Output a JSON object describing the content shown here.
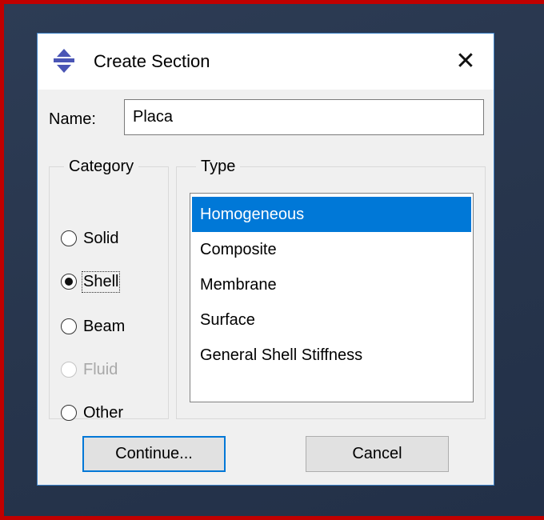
{
  "dialog": {
    "title": "Create Section",
    "close_glyph": "✕",
    "icon": "section-app-icon"
  },
  "name_field": {
    "label": "Name:",
    "value": "Placa"
  },
  "category": {
    "legend": "Category",
    "options": [
      {
        "label": "Solid",
        "checked": false,
        "disabled": false
      },
      {
        "label": "Shell",
        "checked": true,
        "disabled": false
      },
      {
        "label": "Beam",
        "checked": false,
        "disabled": false
      },
      {
        "label": "Fluid",
        "checked": false,
        "disabled": true
      },
      {
        "label": "Other",
        "checked": false,
        "disabled": false
      }
    ]
  },
  "type": {
    "legend": "Type",
    "items": [
      "Homogeneous",
      "Composite",
      "Membrane",
      "Surface",
      "General Shell Stiffness"
    ],
    "selected": "Homogeneous"
  },
  "buttons": {
    "continue_label": "Continue...",
    "cancel_label": "Cancel"
  },
  "colors": {
    "selection": "#0078d7",
    "frame_border": "#c00000",
    "desktop": "#2b3a52"
  }
}
